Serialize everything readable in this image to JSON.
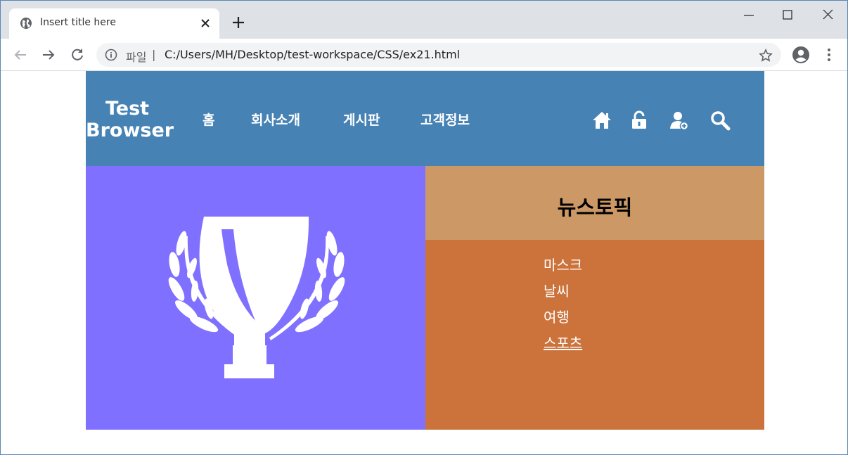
{
  "browser": {
    "tab_title": "Insert title here",
    "scheme_label": "파일",
    "separator": "|",
    "url": "C:/Users/MH/Desktop/test-workspace/CSS/ex21.html"
  },
  "page": {
    "logo_line1": "Test",
    "logo_line2": "Browser",
    "nav": [
      "홈",
      "회사소개",
      "게시판",
      "고객정보"
    ],
    "header_icons": [
      "home-icon",
      "unlock-icon",
      "add-user-icon",
      "search-icon"
    ],
    "news_title": "뉴스토픽",
    "news_items": [
      "마스크",
      "날씨",
      "여행",
      "스포츠"
    ]
  },
  "colors": {
    "header": "#4682b4",
    "left_panel": "#8070ff",
    "news_head": "#cc9966",
    "news_body": "#cc723b"
  }
}
